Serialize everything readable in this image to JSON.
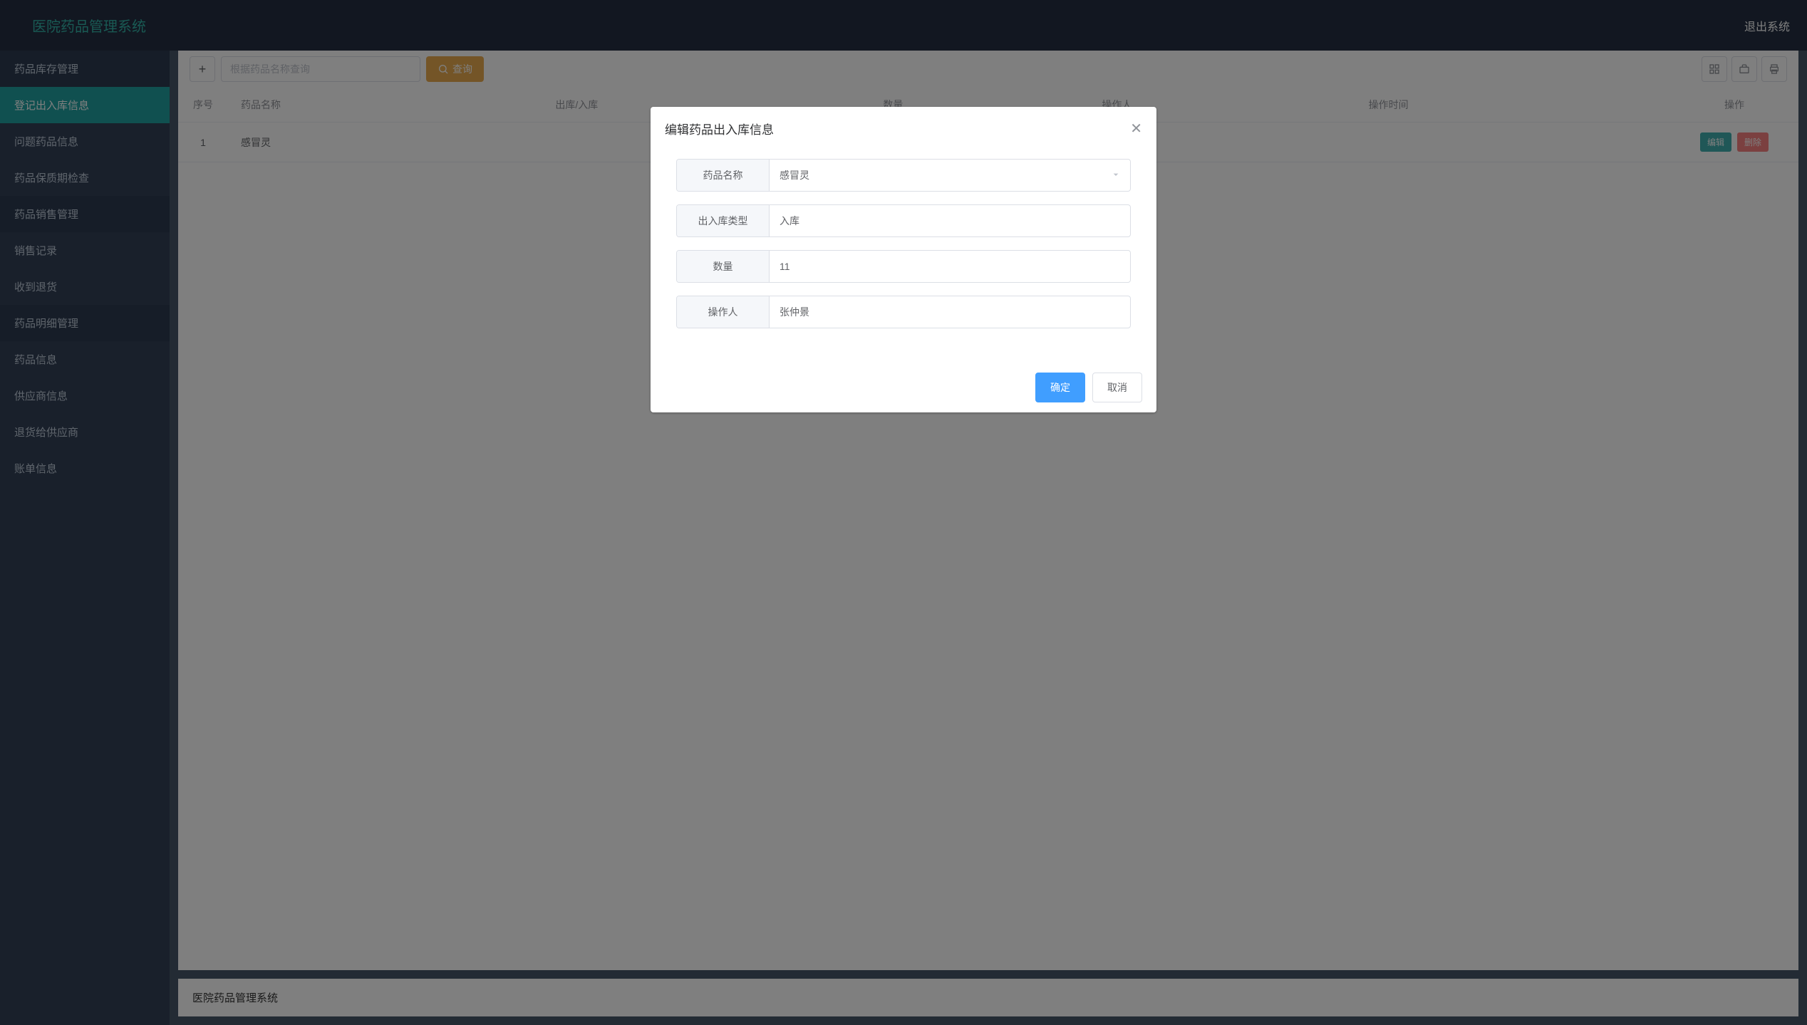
{
  "header": {
    "title": "医院药品管理系统",
    "logout": "退出系统"
  },
  "sidebar": {
    "groups": [
      {
        "title": "药品库存管理",
        "items": [
          {
            "label": "登记出入库信息",
            "active": true
          },
          {
            "label": "问题药品信息"
          },
          {
            "label": "药品保质期检查"
          }
        ]
      },
      {
        "title": "药品销售管理",
        "items": [
          {
            "label": "销售记录"
          },
          {
            "label": "收到退货"
          }
        ]
      },
      {
        "title": "药品明细管理",
        "items": [
          {
            "label": "药品信息"
          },
          {
            "label": "供应商信息"
          },
          {
            "label": "退货给供应商"
          },
          {
            "label": "账单信息"
          }
        ]
      }
    ]
  },
  "toolbar": {
    "search_placeholder": "根据药品名称查询",
    "search_button": "查询"
  },
  "table": {
    "columns": [
      "序号",
      "药品名称",
      "出库/入库",
      "数量",
      "操作人",
      "操作时间",
      "操作"
    ],
    "rows": [
      {
        "index": "1",
        "name": "感冒灵"
      }
    ],
    "actions": {
      "edit": "编辑",
      "delete": "删除"
    }
  },
  "modal": {
    "title": "编辑药品出入库信息",
    "fields": {
      "drug_name": {
        "label": "药品名称",
        "value": "感冒灵"
      },
      "type": {
        "label": "出入库类型",
        "value": "入库"
      },
      "quantity": {
        "label": "数量",
        "value": "11"
      },
      "operator": {
        "label": "操作人",
        "value": "张仲景"
      }
    },
    "confirm": "确定",
    "cancel": "取消"
  },
  "footer": {
    "text": "医院药品管理系统"
  }
}
